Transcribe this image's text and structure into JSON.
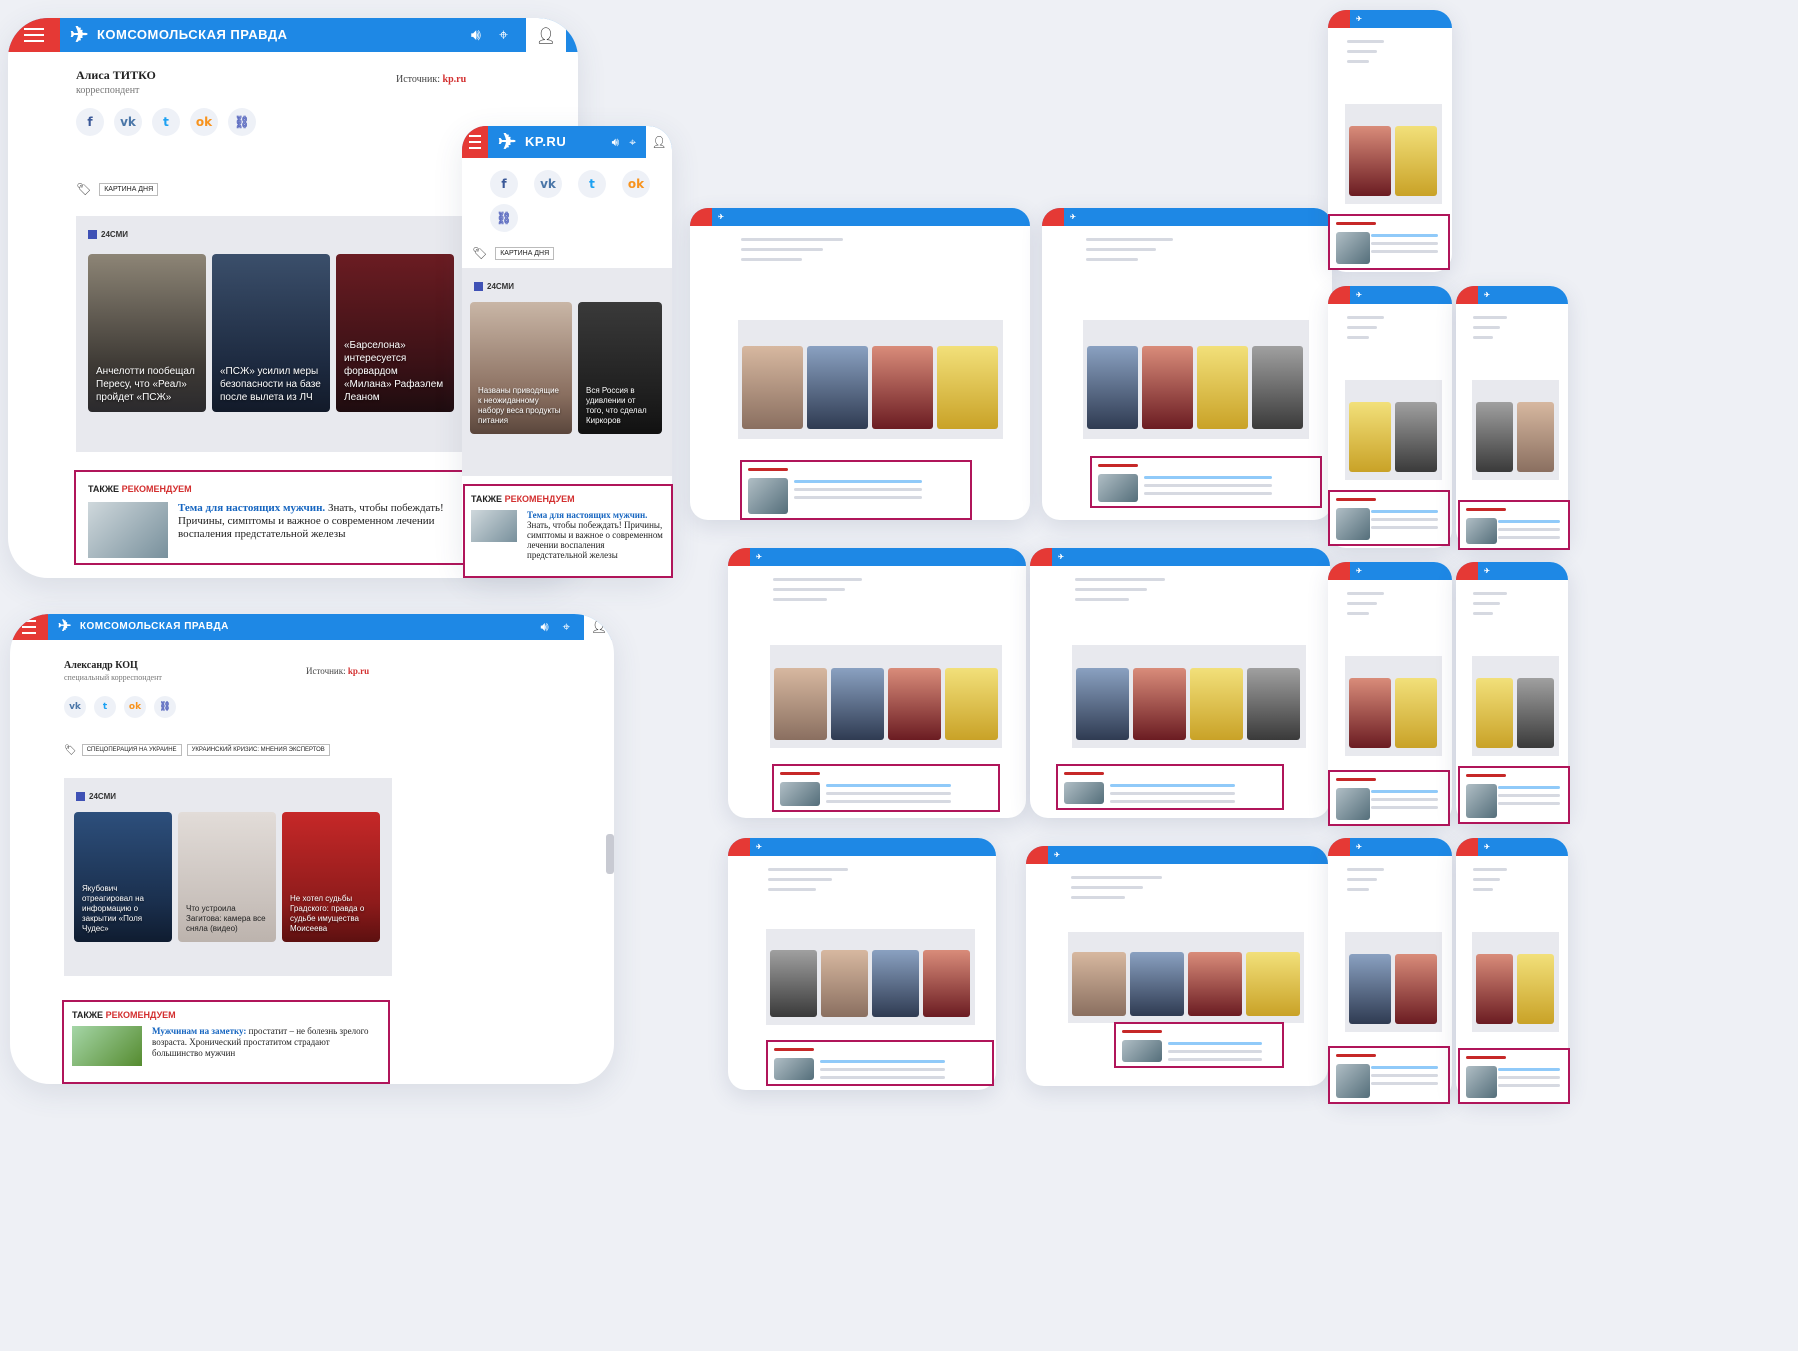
{
  "brand": {
    "logo_text": "КОМСОМОЛЬСКАЯ ПРАВДА",
    "short_logo": "KP.RU",
    "accent": "#1e88e5",
    "red": "#e53935",
    "frame": "#b0155a"
  },
  "icons": {
    "menu": "hamburger-icon",
    "sound": "speaker-icon",
    "geo": "location-pin-icon",
    "user": "user-icon",
    "tag": "tag-icon"
  },
  "card1": {
    "author_name": "Алиса ТИТКО",
    "author_role": "корреспондент",
    "source_label": "Источник:",
    "source_value": "kp.ru",
    "tag": "КАРТИНА ДНЯ",
    "smi_label": "24СМИ",
    "tiles": [
      "Анчелотти пообещал Пересу, что «Реал» пройдет «ПСЖ»",
      "«ПСЖ» усилил меры безопасности на базе после вылета из ЛЧ",
      "«Барселона» интересуется форвардом «Милана» Рафаэлем Леаном"
    ],
    "rec_head_a": "ТАКЖЕ ",
    "rec_head_b": "РЕКОМЕНДУЕМ",
    "rec_link": "Тема для настоящих мужчин.",
    "rec_text": " Знать, чтобы побеждать! Причины, симптомы и важное о современном лечении воспаления предстательной железы"
  },
  "card2": {
    "tag": "КАРТИНА ДНЯ",
    "smi_label": "24СМИ",
    "tiles": [
      "Названы приводящие к неожиданному набору веса продукты питания",
      "Вся Россия в удивлении от того, что сделал Киркоров"
    ],
    "rec_head_a": "ТАКЖЕ ",
    "rec_head_b": "РЕКОМЕНДУЕМ",
    "rec_link": "Тема для настоящих мужчин.",
    "rec_text": " Знать, чтобы побеждать! Причины, симптомы и важное о современном лечении воспаления предстательной железы"
  },
  "card3": {
    "author_name": "Александр КОЦ",
    "author_role": "специальный корреспондент",
    "source_label": "Источник:",
    "source_value": "kp.ru",
    "tag1": "СПЕЦОПЕРАЦИЯ НА УКРАИНЕ",
    "tag2": "УКРАИНСКИЙ КРИЗИС: МНЕНИЯ ЭКСПЕРТОВ",
    "smi_label": "24СМИ",
    "tiles": [
      "Якубович отреагировал на информацию о закрытии «Поля Чудес»",
      "Что устроила Загитова: камера все сняла (видео)",
      "Не хотел судьбы Градского: правда о судьбе имущества Моисеева"
    ],
    "rec_head_a": "ТАКЖЕ ",
    "rec_head_b": "РЕКОМЕНДУЕМ",
    "rec_link": "Мужчинам на заметку:",
    "rec_text": " простатит – не болезнь зрелого возраста. Хронический простатитом страдают большинство мужчин"
  }
}
